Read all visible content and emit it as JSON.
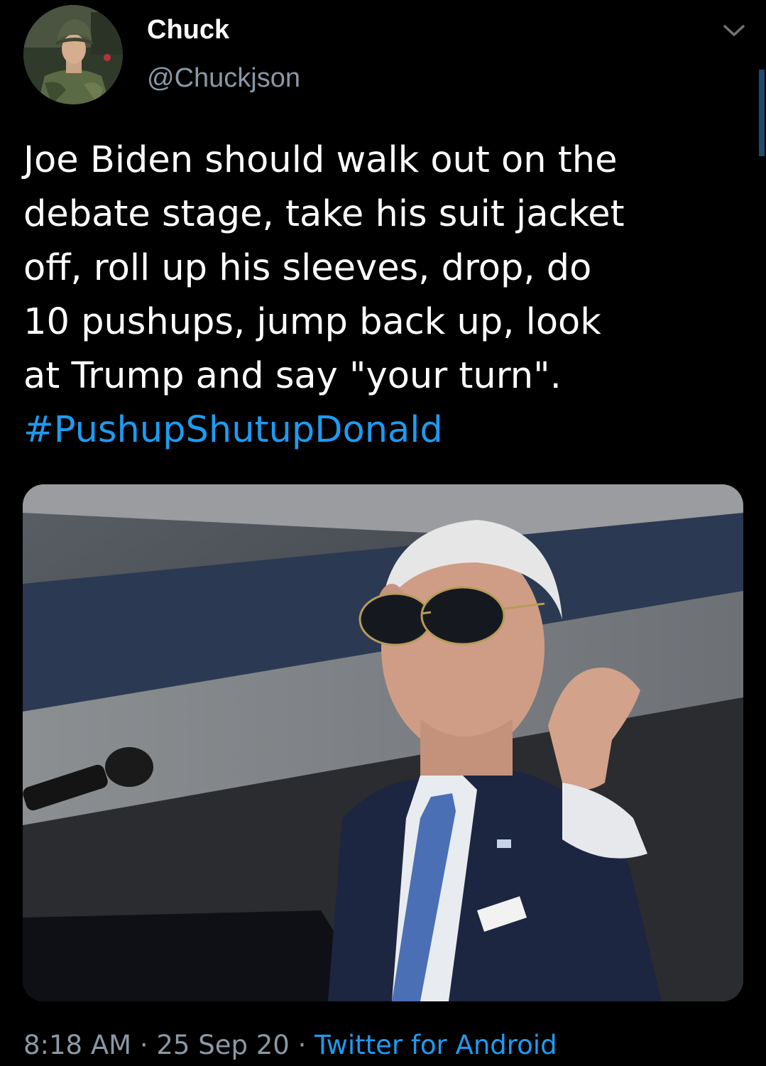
{
  "tweet": {
    "author": {
      "display_name": "Chuck",
      "handle": "@Chuckjson",
      "avatar_icon": "avatar-photo-soldier"
    },
    "text_lines": [
      "Joe Biden should walk out on the",
      "debate stage, take his suit jacket",
      "off, roll up his sleeves, drop, do",
      "10 pushups, jump back up, look",
      "at Trump and say \"your turn\"."
    ],
    "hashtag": "#PushupShutupDonald",
    "media_icon": "photo-man-with-sunglasses-at-podium",
    "time": "8:18 AM",
    "separator": " · ",
    "date": "25 Sep 20",
    "source": "Twitter for Android",
    "menu_icon": "chevron-down-icon"
  },
  "colors": {
    "background": "#000000",
    "text": "#ffffff",
    "secondary": "#8b98a5",
    "link": "#1d9bf0"
  }
}
